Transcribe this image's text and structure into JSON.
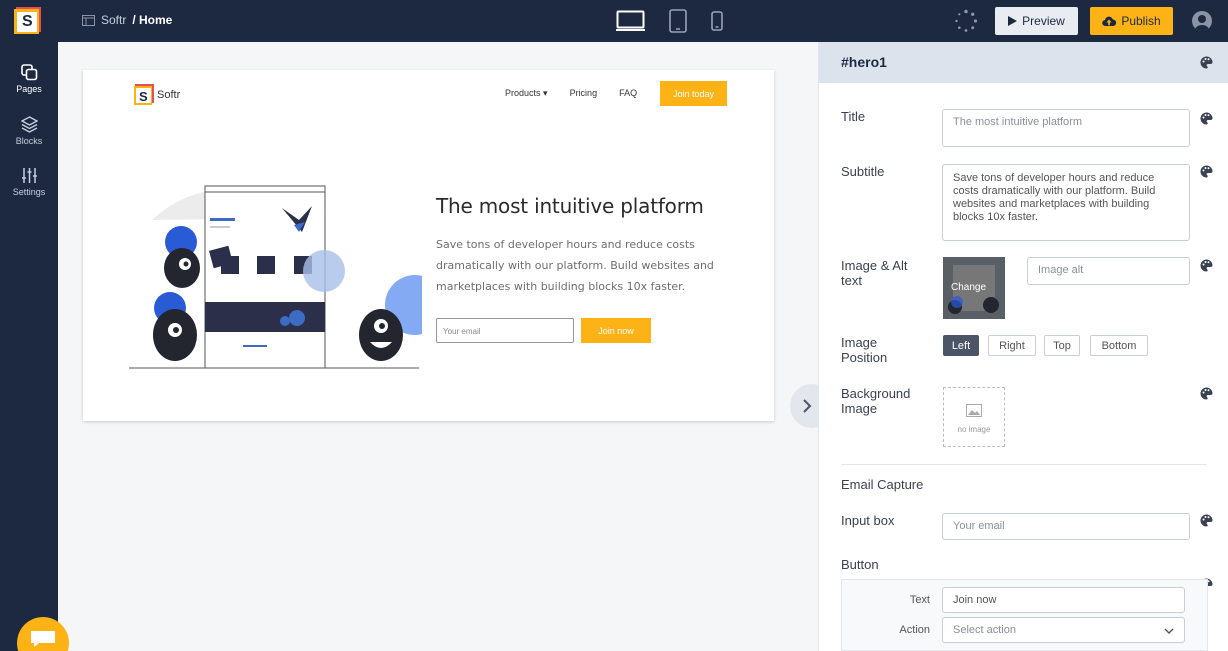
{
  "topbar": {
    "logo_letter": "S",
    "crumb_site": "Softr",
    "crumb_page": "/ Home",
    "devices": [
      "desktop-icon",
      "tablet-icon",
      "mobile-icon"
    ],
    "preview_label": "Preview",
    "publish_label": "Publish"
  },
  "leftnav": {
    "items": [
      {
        "label": "Pages",
        "icon": "pages-icon"
      },
      {
        "label": "Blocks",
        "icon": "blocks-icon"
      },
      {
        "label": "Settings",
        "icon": "settings-icon"
      }
    ]
  },
  "preview": {
    "logo_text": "Softr",
    "nav": [
      "Products",
      "Pricing",
      "FAQ"
    ],
    "join_label": "Join today",
    "hero_title": "The most intuitive platform",
    "hero_subtitle": "Save tons of developer hours and reduce costs dramatically with our platform. Build websites and marketplaces with building blocks 10x faster.",
    "email_placeholder": "Your email",
    "cta_label": "Join now"
  },
  "panel": {
    "block_id": "#hero1",
    "title_label": "Title",
    "title_value": "The most intuitive platform",
    "subtitle_label": "Subtitle",
    "subtitle_value": "Save tons of developer hours and reduce costs dramatically with our platform. Build websites and marketplaces with building blocks 10x faster.",
    "image_label_1": "Image & Alt",
    "image_label_2": "text",
    "image_overlay": "Change",
    "image_alt_placeholder": "Image alt",
    "position_label_1": "Image",
    "position_label_2": "Position",
    "positions": [
      "Left",
      "Right",
      "Top",
      "Bottom"
    ],
    "active_position": "Left",
    "bg_label_1": "Background",
    "bg_label_2": "Image",
    "bg_empty": "no image",
    "email_section": "Email Capture",
    "input_box_label": "Input box",
    "input_box_value": "Your email",
    "button_label": "Button",
    "text_label": "Text",
    "text_value": "Join now",
    "action_label": "Action",
    "action_placeholder": "Select action"
  },
  "colors": {
    "navy": "#1c2940",
    "accent": "#fdb316"
  }
}
